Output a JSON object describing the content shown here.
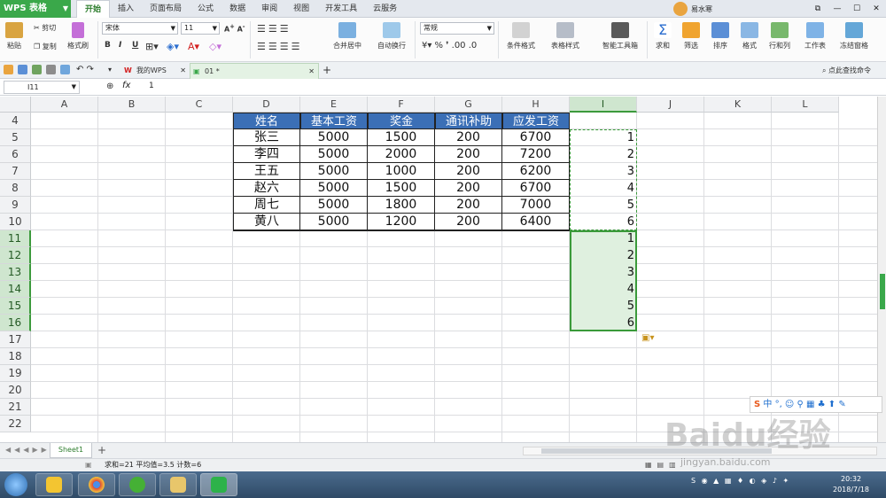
{
  "app": {
    "title": "WPS 表格"
  },
  "menu": [
    "开始",
    "插入",
    "页面布局",
    "公式",
    "数据",
    "审阅",
    "视图",
    "开发工具",
    "云服务"
  ],
  "user": {
    "name": "易水寒"
  },
  "ribbon": {
    "paste": "粘贴",
    "cut": "剪切",
    "copy": "复制",
    "format_painter": "格式刷",
    "font": "宋体",
    "size": "11",
    "bold": "B",
    "italic": "I",
    "underline": "U",
    "merge": "合并居中",
    "wrap": "自动换行",
    "numfmt": "常规",
    "cond": "条件格式",
    "tblstyle": "表格样式",
    "smart": "智能工具箱",
    "sum": "求和",
    "filter": "筛选",
    "sort": "排序",
    "fmt": "格式",
    "rowcol": "行和列",
    "sheet": "工作表",
    "freeze": "冻结窗格"
  },
  "tabs": {
    "home": "我的WPS",
    "doc": "01 *",
    "search": "点此查找命令"
  },
  "formula": {
    "cell": "I11",
    "fx": "fx",
    "value": "1"
  },
  "columns": [
    "A",
    "B",
    "C",
    "D",
    "E",
    "F",
    "G",
    "H",
    "I",
    "J",
    "K",
    "L"
  ],
  "rows": [
    "4",
    "5",
    "6",
    "7",
    "8",
    "9",
    "10",
    "11",
    "12",
    "13",
    "14",
    "15",
    "16",
    "17",
    "18",
    "19",
    "20",
    "21",
    "22"
  ],
  "table": {
    "headers": [
      "姓名",
      "基本工资",
      "奖金",
      "通讯补助",
      "应发工资"
    ],
    "rows": [
      [
        "张三",
        "5000",
        "1500",
        "200",
        "6700"
      ],
      [
        "李四",
        "5000",
        "2000",
        "200",
        "7200"
      ],
      [
        "王五",
        "5000",
        "1000",
        "200",
        "6200"
      ],
      [
        "赵六",
        "5000",
        "1500",
        "200",
        "6700"
      ],
      [
        "周七",
        "5000",
        "1800",
        "200",
        "7000"
      ],
      [
        "黄八",
        "5000",
        "1200",
        "200",
        "6400"
      ]
    ]
  },
  "col_i_values": [
    "1",
    "2",
    "3",
    "4",
    "5",
    "6",
    "1",
    "2",
    "3",
    "4",
    "5",
    "6"
  ],
  "sheet_tab": "Sheet1",
  "status": "求和=21  平均值=3.5  计数=6",
  "clock": {
    "time": "20:32",
    "date": "2018/7/18"
  },
  "ime": "中",
  "watermark": "Baidu经验",
  "watermark_url": "jingyan.baidu.com",
  "colors": {
    "accent": "#3aa84a",
    "header_fill": "#3b6fb6"
  }
}
